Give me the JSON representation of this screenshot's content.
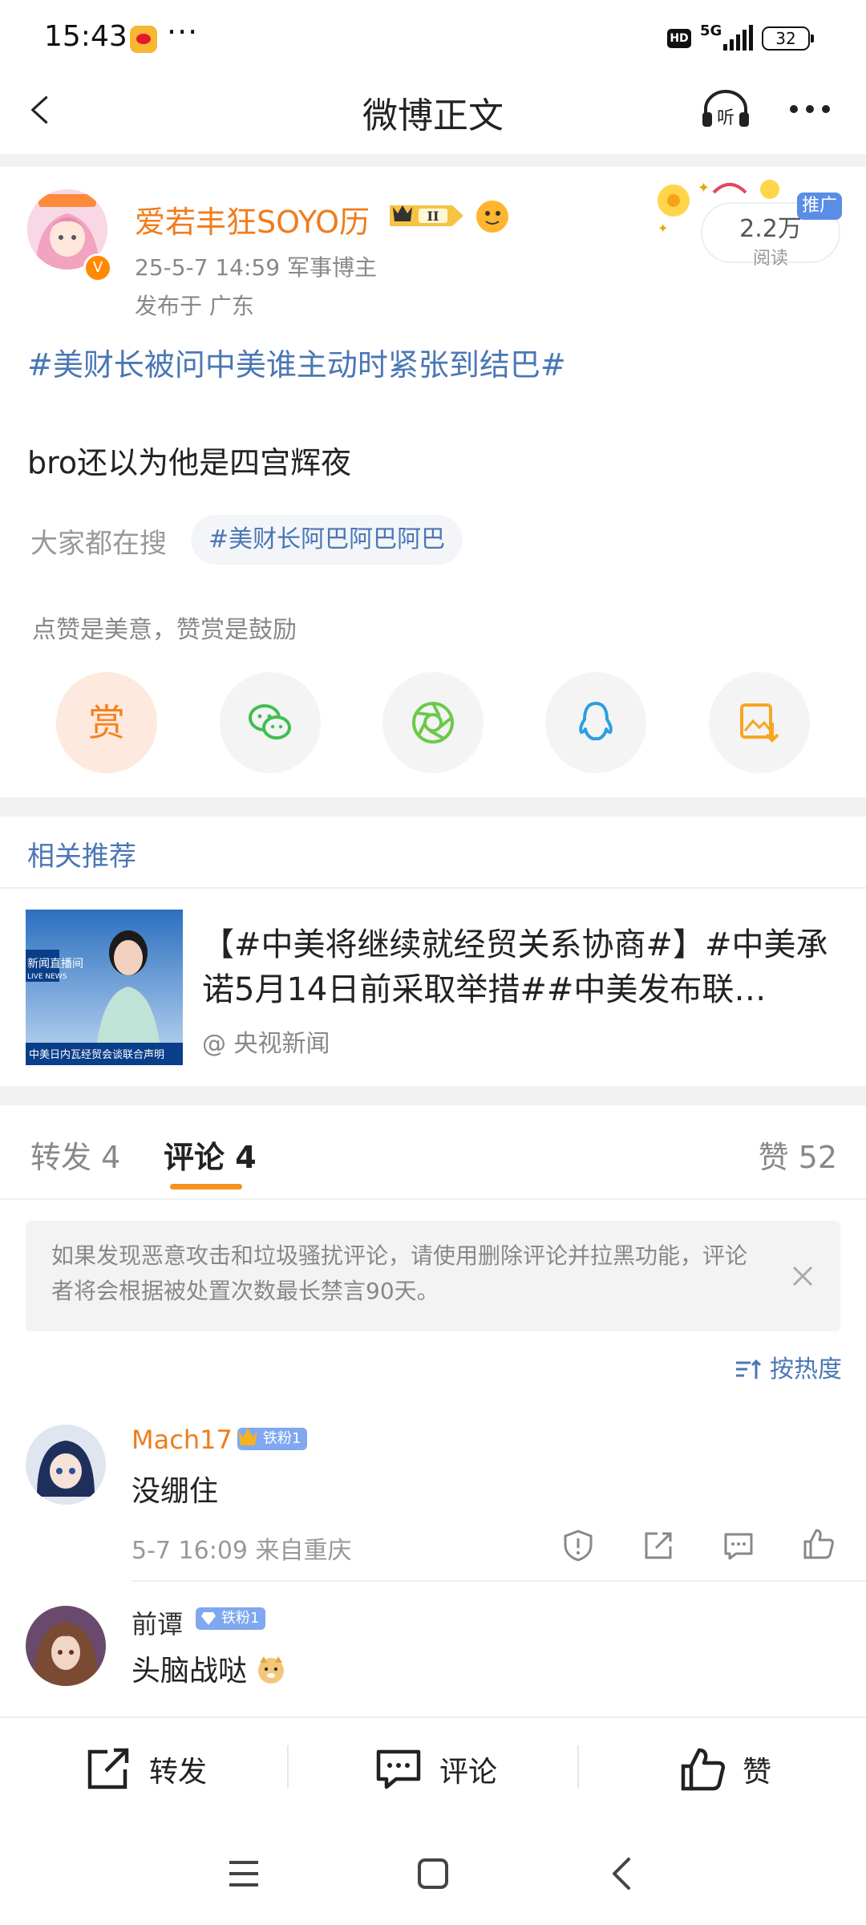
{
  "status_bar": {
    "time": "15:43",
    "dots": "···",
    "hd": "HD",
    "network": "5G",
    "battery": "32"
  },
  "nav": {
    "title": "微博正文"
  },
  "post": {
    "author": "爱若丰狂SOYO历",
    "avatar_badge": "V",
    "meta": "25-5-7 14:59   军事博主",
    "location": "发布于 广东",
    "read_count": "2.2万",
    "read_label": "阅读",
    "promo_tag": "推广",
    "topic": "#美财长被问中美谁主动时紧张到结巴#",
    "text": "bro还以为他是四宫辉夜",
    "search_label": "大家都在搜",
    "hot_search": "#美财长阿巴阿巴阿巴",
    "like_hint": "点赞是美意，赞赏是鼓励",
    "reward_label": "赏"
  },
  "related": {
    "title": "相关推荐",
    "item_text": "【#中美将继续就经贸关系协商#】#中美承诺5月14日前采取举措##中美发布联…",
    "item_source": "@ 央视新闻",
    "thumb_caption": "中美日内瓦经贸会谈联合声明",
    "thumb_logo": "新闻直播间",
    "thumb_logo_en": "LIVE NEWS"
  },
  "tabs": {
    "repost": "转发 4",
    "comment": "评论 4",
    "likes": "赞 52"
  },
  "notice": "如果发现恶意攻击和垃圾骚扰评论，请使用删除评论并拉黑功能，评论者将会根据被处置次数最长禁言90天。",
  "sort_label": "按热度",
  "comments": [
    {
      "name": "Mach17",
      "fan_badge": "铁粉1",
      "text": "没绷住",
      "meta": "5-7 16:09  来自重庆"
    },
    {
      "name": "前谭",
      "fan_badge": "铁粉1",
      "text": "头脑战哒"
    }
  ],
  "bottom_bar": {
    "repost": "转发",
    "comment": "评论",
    "like": "赞"
  },
  "colors": {
    "accent_orange": "#f07c1b",
    "link_blue": "#4a77b5",
    "tab_underline": "#f7901e"
  }
}
